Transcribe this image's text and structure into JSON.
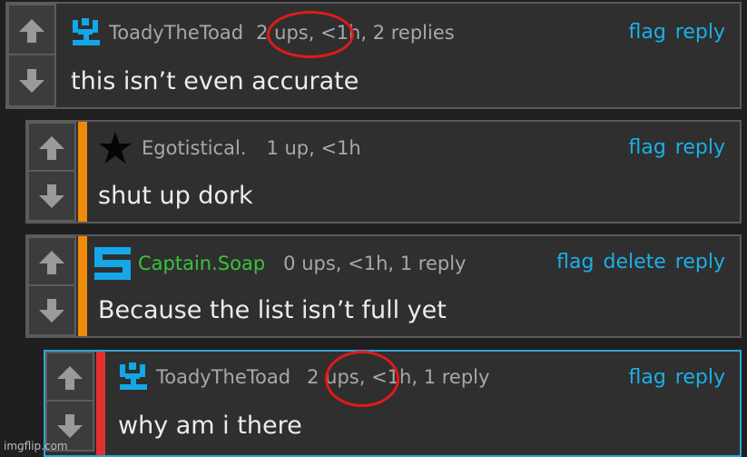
{
  "comments": [
    {
      "username": "ToadyTheToad",
      "meta": "2 ups, <1h, 2 replies",
      "actions": [
        "flag",
        "reply"
      ],
      "text": "this isn’t even accurate"
    },
    {
      "username": "Egotistical.",
      "meta": "1 up, <1h",
      "actions": [
        "flag",
        "reply"
      ],
      "text": "shut up dork"
    },
    {
      "username": "Captain.Soap",
      "meta": "0 ups, <1h, 1 reply",
      "actions": [
        "flag",
        "delete",
        "reply"
      ],
      "text": "Because the list isn’t full yet"
    },
    {
      "username": "ToadyTheToad",
      "meta": "2 ups, <1h, 1 reply",
      "actions": [
        "flag",
        "reply"
      ],
      "text": "why am i there"
    }
  ],
  "watermark": "imgflip.com",
  "colors": {
    "link": "#1ab0e8",
    "accent_orange": "#f08a0a",
    "accent_red": "#e03030",
    "highlight_border": "#2aa6d6",
    "annotation_circle": "#e01a1a",
    "soap_green": "#3ac23a"
  },
  "icons": {
    "upvote": "arrow-up-icon",
    "downvote": "arrow-down-icon",
    "toad_avatar": "pixel-toad-avatar-icon",
    "star_avatar": "star-avatar-icon",
    "soap_avatar": "s-logo-avatar-icon"
  }
}
